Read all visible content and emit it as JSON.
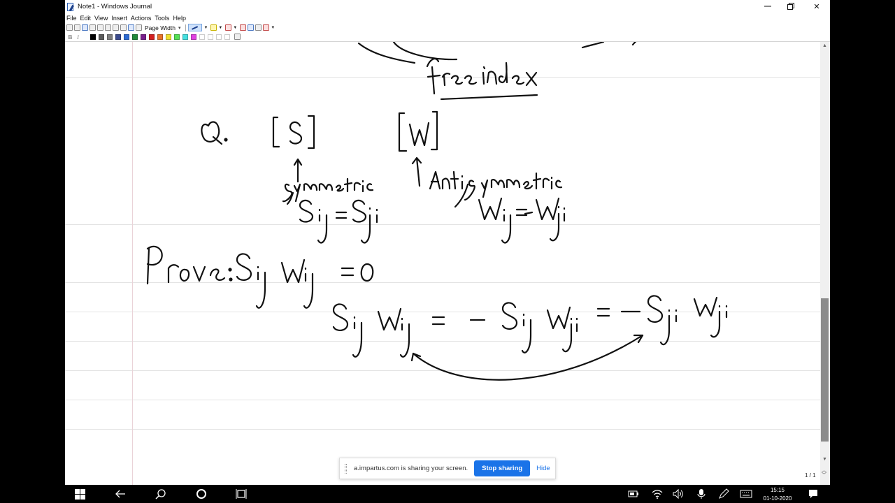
{
  "window": {
    "title": "Note1 - Windows Journal",
    "minimize_icon": "minimize-icon",
    "maximize_icon": "restore-icon",
    "close_glyph": "✕"
  },
  "menu": [
    "File",
    "Edit",
    "View",
    "Insert",
    "Actions",
    "Tools",
    "Help"
  ],
  "toolbar": {
    "zoom_label": "Page Width",
    "bold_label": "B",
    "italic_label": "I",
    "colors": [
      "#000000",
      "#5a5a5a",
      "#7f7f7f",
      "#3a4a8c",
      "#2e6bd3",
      "#1f8a3a",
      "#7a1f8c",
      "#d42020",
      "#e8732a",
      "#f0e030",
      "#55e055",
      "#45e0e0",
      "#e040e0",
      "",
      "",
      "",
      ""
    ]
  },
  "notes": {
    "text_lines": [
      "free index",
      "Q.",
      "[S]",
      "[W]",
      "symmetric",
      "Anti symmetric",
      "S_ij = S_ji",
      "W_ij = -W_ji",
      "Prove: S_ij W_ij = 0",
      "S_ij W_ij = - S_ij W_ji = - S_ji W_ji"
    ]
  },
  "page_indicator": "1 / 1",
  "share_bar": {
    "message": "a.impartus.com is sharing your screen.",
    "stop_label": "Stop sharing",
    "hide_label": "Hide"
  },
  "taskbar": {
    "icons": [
      "windows-start-icon",
      "back-arrow-icon",
      "search-icon",
      "cortana-icon",
      "task-view-icon",
      "battery-icon",
      "wifi-icon",
      "volume-icon",
      "microphone-icon",
      "pen-icon",
      "keyboard-icon",
      "notification-icon"
    ],
    "time": "15:15",
    "date": "01-10-2020"
  },
  "colors": {
    "stop_button": "#1a73e8",
    "ink": "#111111",
    "ruled_line": "#e3e3e3",
    "margin_line": "#ead3d8"
  }
}
